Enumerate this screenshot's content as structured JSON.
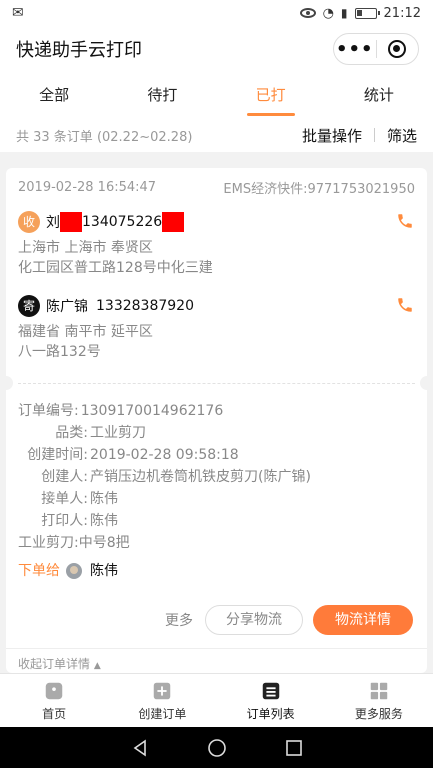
{
  "status_bar": {
    "time": "21:12",
    "signal_icon": "signal-icon",
    "battery_icon": "battery-icon"
  },
  "app": {
    "title": "快递助手云打印"
  },
  "tabs": [
    {
      "label": "全部"
    },
    {
      "label": "待打"
    },
    {
      "label": "已打",
      "active": true
    },
    {
      "label": "统计"
    }
  ],
  "filter": {
    "count_text": "共 33 条订单 (02.22~02.28)",
    "batch_label": "批量操作",
    "filter_label": "筛选"
  },
  "order": {
    "datetime": "2019-02-28 16:54:47",
    "express": "EMS经济快件:9771753021950",
    "receiver": {
      "badge": "收",
      "name_prefix": "刘",
      "phone_part": "134075226",
      "addr1": "上海市 上海市 奉贤区",
      "addr2": "化工园区普工路128号中化三建"
    },
    "sender": {
      "badge": "寄",
      "name": "陈广锦",
      "phone": "13328387920",
      "addr1": "福建省 南平市 延平区",
      "addr2": "八一路132号"
    },
    "details": {
      "order_no_label": "订单编号:",
      "order_no": "1309170014962176",
      "category_label": "品类:",
      "category": "工业剪刀",
      "created_label": "创建时间:",
      "created": "2019-02-28 09:58:18",
      "creator_label": "创建人:",
      "creator": "产销压边机卷筒机铁皮剪刀(陈广锦)",
      "receiver_label": "接单人:",
      "receiver_person": "陈伟",
      "printer_label": "打印人:",
      "printer_person": "陈伟",
      "item_line": "工业剪刀:中号8把"
    },
    "assign": {
      "tag": "下单给",
      "name": "陈伟"
    },
    "actions": {
      "more": "更多",
      "share": "分享物流",
      "detail": "物流详情"
    },
    "collapse_label": "收起订单详情"
  },
  "bottom_nav": [
    {
      "label": "首页",
      "icon": "home-icon"
    },
    {
      "label": "创建订单",
      "icon": "plus-icon"
    },
    {
      "label": "订单列表",
      "icon": "list-icon",
      "active": true
    },
    {
      "label": "更多服务",
      "icon": "grid-icon"
    }
  ],
  "colors": {
    "accent": "#ff7b3a",
    "active_tab": "#ff8b3d",
    "redaction": "#ff0000"
  }
}
